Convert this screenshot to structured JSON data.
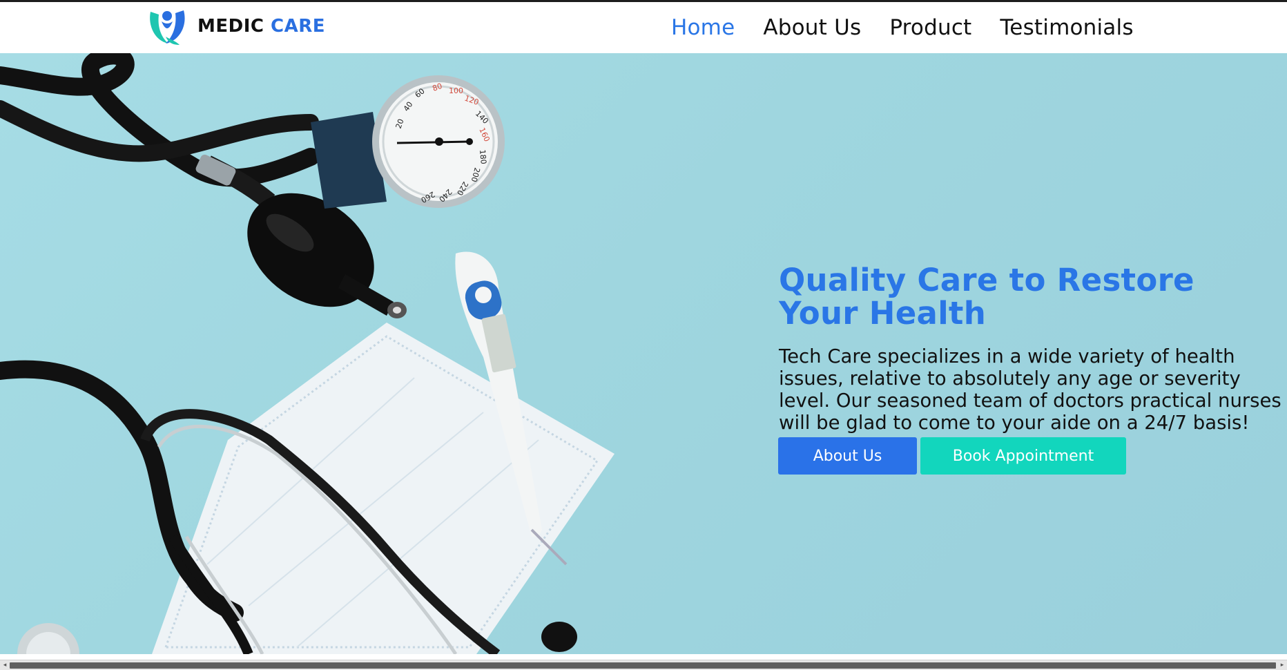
{
  "brand": {
    "name_part1": "MEDIC",
    "name_part2": "CARE",
    "logo_icon": "person-leaf-logo-icon",
    "colors": {
      "primary": "#2a6fe0",
      "teal": "#12c9b2"
    }
  },
  "nav": {
    "items": [
      {
        "label": "Home",
        "active": true
      },
      {
        "label": "About Us",
        "active": false
      },
      {
        "label": "Product",
        "active": false
      },
      {
        "label": "Testimonials",
        "active": false
      }
    ],
    "active_color": "#2a76e6"
  },
  "hero": {
    "title": "Quality Care to Restore Your Health",
    "description": "Tech Care specializes in a wide variety of health issues, relative to absolutely any age or severity level. Our seasoned team of doctors practical nurses will be glad to come to your aide on a 24/7 basis!",
    "buttons": {
      "about_label": "About Us",
      "book_label": "Book Appointment"
    },
    "background_color": "#a3d8e2",
    "image_subject": "stethoscope, blood-pressure gauge, thermometer and face mask",
    "gauge_ticks": [
      "20",
      "40",
      "60",
      "80",
      "100",
      "120",
      "140",
      "160",
      "180",
      "200",
      "220",
      "240",
      "260"
    ]
  },
  "scrollbar": {
    "left_arrow": "◂",
    "right_arrow": "▸"
  }
}
